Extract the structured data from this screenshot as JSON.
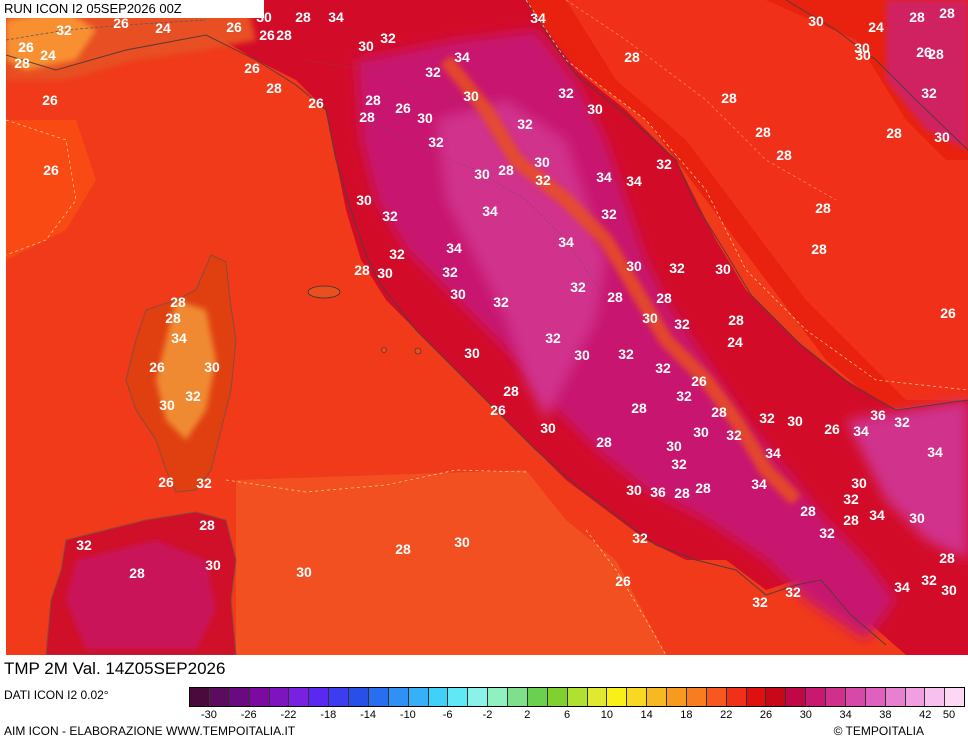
{
  "header": {
    "run_title": "RUN ICON I2 05SEP2026 00Z"
  },
  "map": {
    "variable_title": "TMP 2M Val. 14Z05SEP2026",
    "labels": [
      {
        "t": "32"
      },
      {
        "t": "26"
      },
      {
        "t": "26"
      },
      {
        "t": "24"
      },
      {
        "t": "26"
      },
      {
        "t": "28"
      },
      {
        "t": "30"
      },
      {
        "t": "34"
      },
      {
        "t": "34"
      },
      {
        "t": "28"
      },
      {
        "t": "28"
      },
      {
        "t": "30"
      },
      {
        "t": "28"
      },
      {
        "t": "26"
      },
      {
        "t": "24"
      },
      {
        "t": "28"
      },
      {
        "t": "26"
      },
      {
        "t": "24"
      },
      {
        "t": "30"
      },
      {
        "t": "26"
      },
      {
        "t": "28"
      },
      {
        "t": "30"
      },
      {
        "t": "32"
      },
      {
        "t": "26"
      },
      {
        "t": "28"
      },
      {
        "t": "26"
      },
      {
        "t": "30"
      },
      {
        "t": "32"
      },
      {
        "t": "34"
      },
      {
        "t": "32"
      },
      {
        "t": "28"
      },
      {
        "t": "28"
      },
      {
        "t": "32"
      },
      {
        "t": "26"
      },
      {
        "t": "28"
      },
      {
        "t": "26"
      },
      {
        "t": "30"
      },
      {
        "t": "28"
      },
      {
        "t": "30"
      },
      {
        "t": "32"
      },
      {
        "t": "30"
      },
      {
        "t": "28"
      },
      {
        "t": "28"
      },
      {
        "t": "30"
      },
      {
        "t": "26"
      },
      {
        "t": "32"
      },
      {
        "t": "30"
      },
      {
        "t": "28"
      },
      {
        "t": "30"
      },
      {
        "t": "32"
      },
      {
        "t": "34"
      },
      {
        "t": "34"
      },
      {
        "t": "32"
      },
      {
        "t": "28"
      },
      {
        "t": "30"
      },
      {
        "t": "32"
      },
      {
        "t": "34"
      },
      {
        "t": "32"
      },
      {
        "t": "28"
      },
      {
        "t": "32"
      },
      {
        "t": "34"
      },
      {
        "t": "34"
      },
      {
        "t": "28"
      },
      {
        "t": "28"
      },
      {
        "t": "30"
      },
      {
        "t": "32"
      },
      {
        "t": "30"
      },
      {
        "t": "32"
      },
      {
        "t": "30"
      },
      {
        "t": "28"
      },
      {
        "t": "30"
      },
      {
        "t": "32"
      },
      {
        "t": "32"
      },
      {
        "t": "28"
      },
      {
        "t": "28"
      },
      {
        "t": "30"
      },
      {
        "t": "32"
      },
      {
        "t": "28"
      },
      {
        "t": "26"
      },
      {
        "t": "28"
      },
      {
        "t": "34"
      },
      {
        "t": "32"
      },
      {
        "t": "30"
      },
      {
        "t": "32"
      },
      {
        "t": "24"
      },
      {
        "t": "26"
      },
      {
        "t": "30"
      },
      {
        "t": "30"
      },
      {
        "t": "32"
      },
      {
        "t": "26"
      },
      {
        "t": "32"
      },
      {
        "t": "28"
      },
      {
        "t": "28"
      },
      {
        "t": "32"
      },
      {
        "t": "30"
      },
      {
        "t": "26"
      },
      {
        "t": "34"
      },
      {
        "t": "36"
      },
      {
        "t": "32"
      },
      {
        "t": "34"
      },
      {
        "t": "30"
      },
      {
        "t": "30"
      },
      {
        "t": "32"
      },
      {
        "t": "26"
      },
      {
        "t": "30"
      },
      {
        "t": "28"
      },
      {
        "t": "28"
      },
      {
        "t": "30"
      },
      {
        "t": "32"
      },
      {
        "t": "30"
      },
      {
        "t": "34"
      },
      {
        "t": "32"
      },
      {
        "t": "34"
      },
      {
        "t": "32"
      },
      {
        "t": "28"
      },
      {
        "t": "26"
      },
      {
        "t": "32"
      },
      {
        "t": "30"
      },
      {
        "t": "36"
      },
      {
        "t": "28"
      },
      {
        "t": "28"
      },
      {
        "t": "28"
      },
      {
        "t": "32"
      },
      {
        "t": "28"
      },
      {
        "t": "34"
      },
      {
        "t": "30"
      },
      {
        "t": "32"
      },
      {
        "t": "28"
      },
      {
        "t": "30"
      },
      {
        "t": "32"
      },
      {
        "t": "30"
      },
      {
        "t": "30"
      },
      {
        "t": "28"
      },
      {
        "t": "26"
      },
      {
        "t": "32"
      },
      {
        "t": "32"
      },
      {
        "t": "34"
      },
      {
        "t": "32"
      },
      {
        "t": "28"
      },
      {
        "t": "30"
      }
    ]
  },
  "legend": {
    "source_text": "DATI ICON I2 0.02°",
    "credit_text": "AIM ICON - ELABORAZIONE WWW.TEMPOITALIA.IT",
    "copyright_text": "© TEMPOITALIA",
    "colors": [
      "#4a0a3c",
      "#5c0c5e",
      "#6a0a80",
      "#7a0aa0",
      "#7e14c0",
      "#7a20e0",
      "#5a28f0",
      "#3c3cf0",
      "#2850e8",
      "#2a6ef0",
      "#3090f6",
      "#38b0f8",
      "#40d0f8",
      "#60e8f6",
      "#8af2e8",
      "#90f0c0",
      "#7ee08a",
      "#6ad050",
      "#80d030",
      "#b0e030",
      "#e0e830",
      "#f8f018",
      "#f8d820",
      "#f8b820",
      "#f89a20",
      "#f87c20",
      "#f85820",
      "#f03018",
      "#e01010",
      "#c80818",
      "#c00848",
      "#c81870",
      "#d0308c",
      "#d848a8",
      "#e060c0",
      "#e880d0",
      "#f0a0e0",
      "#f8c0ee",
      "#fcd8f4"
    ],
    "ticks": [
      "-30",
      "-26",
      "-22",
      "-18",
      "-14",
      "-10",
      "-6",
      "-2",
      "2",
      "6",
      "10",
      "14",
      "18",
      "22",
      "26",
      "30",
      "34",
      "38",
      "42",
      "50"
    ]
  }
}
